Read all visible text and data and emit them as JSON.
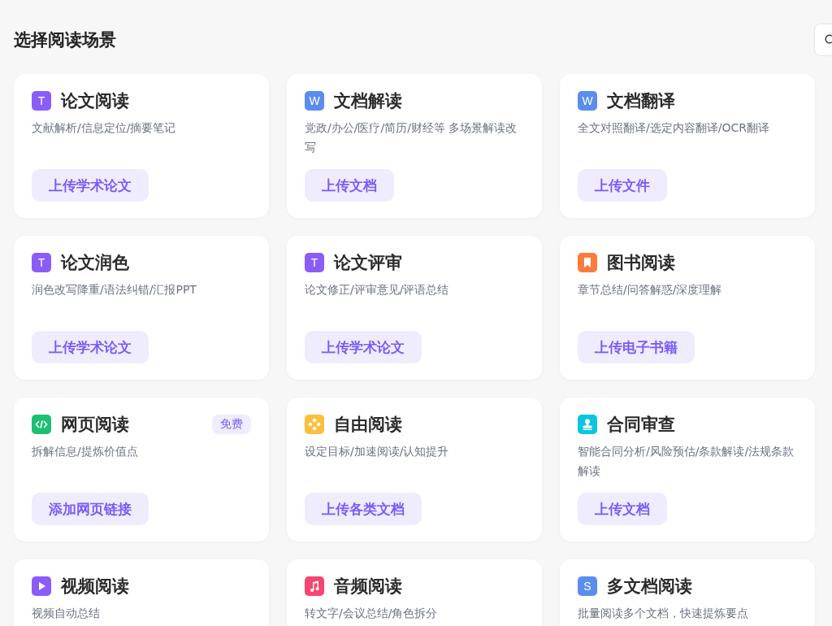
{
  "title": "选择阅读场景",
  "cards": [
    {
      "icon": {
        "kind": "letter",
        "text": "T",
        "color": "#8b5cf6"
      },
      "title": "论文阅读",
      "description": "文献解析/信息定位/摘要笔记",
      "button": "上传学术论文"
    },
    {
      "icon": {
        "kind": "letter",
        "text": "W",
        "color": "#5b8def"
      },
      "title": "文档解读",
      "description": "党政/办公/医疗/简历/财经等 多场景解读改写",
      "button": "上传文档"
    },
    {
      "icon": {
        "kind": "letter",
        "text": "W",
        "color": "#5b8def"
      },
      "title": "文档翻译",
      "description": "全文对照翻译/选定内容翻译/OCR翻译",
      "button": "上传文件"
    },
    {
      "icon": {
        "kind": "letter",
        "text": "T",
        "color": "#8b5cf6"
      },
      "title": "论文润色",
      "description": "润色改写降重/语法纠错/汇报PPT",
      "button": "上传学术论文"
    },
    {
      "icon": {
        "kind": "letter",
        "text": "T",
        "color": "#8b5cf6"
      },
      "title": "论文评审",
      "description": "论文修正/评审意见/评语总结",
      "button": "上传学术论文"
    },
    {
      "icon": {
        "kind": "bookmark",
        "color": "#fb7c3c"
      },
      "title": "图书阅读",
      "description": "章节总结/问答解惑/深度理解",
      "button": "上传电子书籍"
    },
    {
      "icon": {
        "kind": "code",
        "color": "#1dbf73"
      },
      "title": "网页阅读",
      "badge": "免费",
      "description": "拆解信息/提炼价值点",
      "button": "添加网页链接"
    },
    {
      "icon": {
        "kind": "diamond",
        "color": "#fbbf3c"
      },
      "title": "自由阅读",
      "description": "设定目标/加速阅读/认知提升",
      "button": "上传各类文档"
    },
    {
      "icon": {
        "kind": "stamp",
        "color": "#0ec5e0"
      },
      "title": "合同审查",
      "description": "智能合同分析/风险预估/条款解读/法规条款解读",
      "button": "上传文档"
    },
    {
      "icon": {
        "kind": "play",
        "color": "#8b5cf6"
      },
      "title": "视频阅读",
      "description": "视频自动总结"
    },
    {
      "icon": {
        "kind": "music",
        "color": "#f4466e"
      },
      "title": "音频阅读",
      "description": "转文字/会议总结/角色拆分"
    },
    {
      "icon": {
        "kind": "letter",
        "text": "S",
        "color": "#5b8def"
      },
      "title": "多文档阅读",
      "description": "批量阅读多个文档，快速提炼要点"
    }
  ]
}
